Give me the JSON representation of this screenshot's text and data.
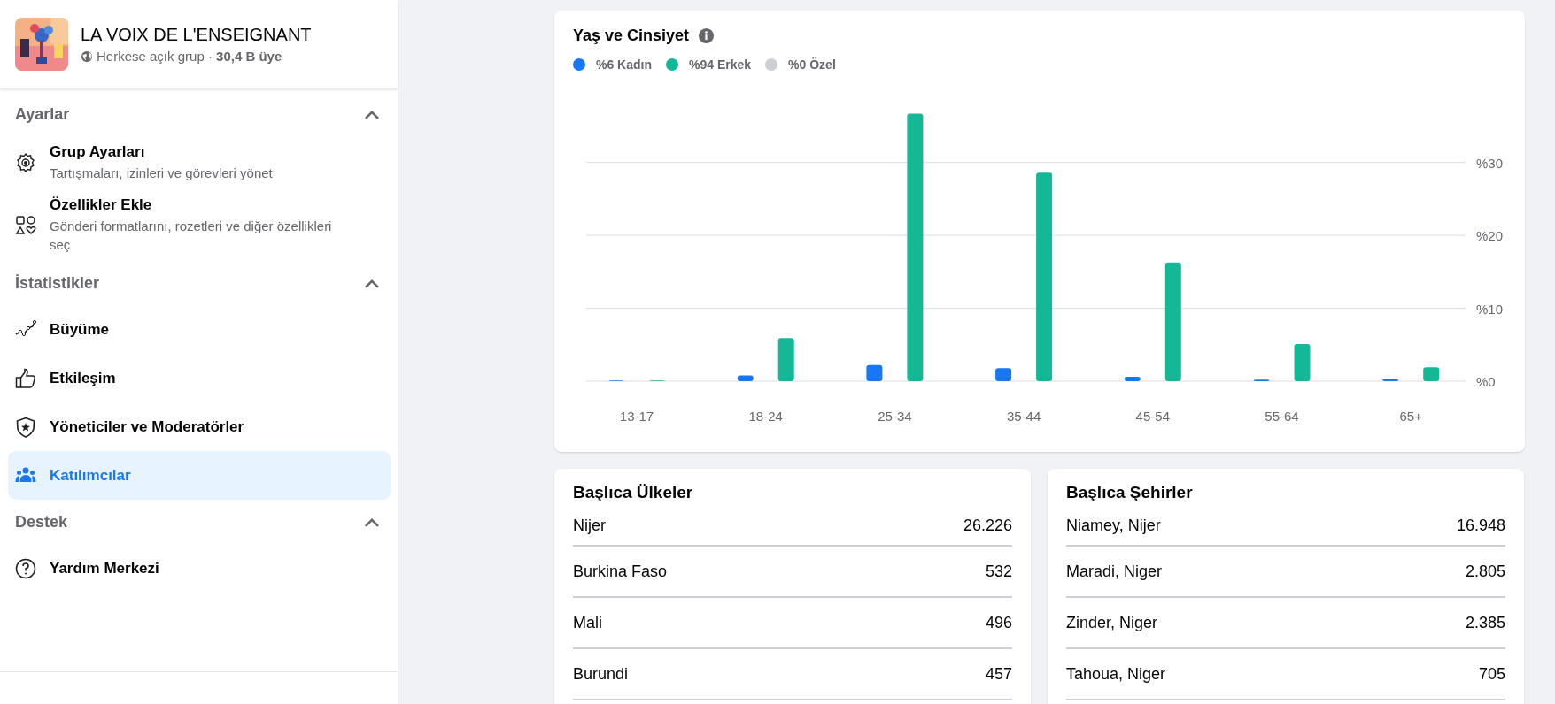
{
  "group": {
    "name": "LA VOIX DE L'ENSEIGNANT",
    "meta": "Herkese açık grup · **30,4 B üye**"
  },
  "sidebar": {
    "sections": [
      {
        "title": "Ayarlar",
        "expanded": true,
        "items": [
          {
            "label": "Grup Ayarları",
            "description": "Tartışmaları, izinleri ve görevleri yönet",
            "selected": false
          },
          {
            "label": "Özellikler Ekle",
            "description": "Gönderi formatlarını, rozetleri ve diğer özellikleri seç",
            "selected": false
          }
        ]
      },
      {
        "title": "İstatistikler",
        "expanded": true,
        "items": [
          {
            "label": "Büyüme",
            "selected": false
          },
          {
            "label": "Etkileşim",
            "selected": false
          },
          {
            "label": "Yöneticiler ve Moderatörler",
            "selected": false
          },
          {
            "label": "Katılımcılar",
            "selected": true
          }
        ]
      },
      {
        "title": "Destek",
        "expanded": true,
        "items": [
          {
            "label": "Yardım Merkezi",
            "selected": false
          }
        ]
      }
    ]
  },
  "age_gender": {
    "title": "Yaş ve Cinsiyet",
    "chart_data": {
      "type": "bar",
      "grid": true,
      "categories": [
        "13-17",
        "18-24",
        "25-34",
        "35-44",
        "45-54",
        "55-64",
        "65+"
      ],
      "series": [
        {
          "name": "%6 Kadın",
          "color": "#1877f2",
          "values": [
            0.1,
            0.8,
            2.2,
            1.8,
            0.6,
            0.2,
            0.3
          ]
        },
        {
          "name": "%94 Erkek",
          "color": "#14b896",
          "values": [
            0.1,
            5.9,
            36.7,
            28.6,
            16.3,
            5.1,
            1.9
          ]
        },
        {
          "name": "%0 Özel",
          "color": "#ccd0d5",
          "values": [
            0,
            0,
            0,
            0,
            0,
            0,
            0
          ]
        }
      ],
      "ylim": [
        0,
        37
      ],
      "yticks": [
        {
          "value": 0,
          "label": "%0"
        },
        {
          "value": 10,
          "label": "%10"
        },
        {
          "value": 20,
          "label": "%20"
        },
        {
          "value": 30,
          "label": "%30"
        }
      ]
    }
  },
  "top_countries": {
    "title": "Başlıca Ülkeler",
    "rows": [
      {
        "name": "Nijer",
        "count": "26.226"
      },
      {
        "name": "Burkina Faso",
        "count": "532"
      },
      {
        "name": "Mali",
        "count": "496"
      },
      {
        "name": "Burundi",
        "count": "457"
      }
    ]
  },
  "top_cities": {
    "title": "Başlıca Şehirler",
    "rows": [
      {
        "name": "Niamey, Nijer",
        "count": "16.948"
      },
      {
        "name": "Maradi, Niger",
        "count": "2.805"
      },
      {
        "name": "Zinder, Niger",
        "count": "2.385"
      },
      {
        "name": "Tahoua, Niger",
        "count": "705"
      }
    ]
  }
}
